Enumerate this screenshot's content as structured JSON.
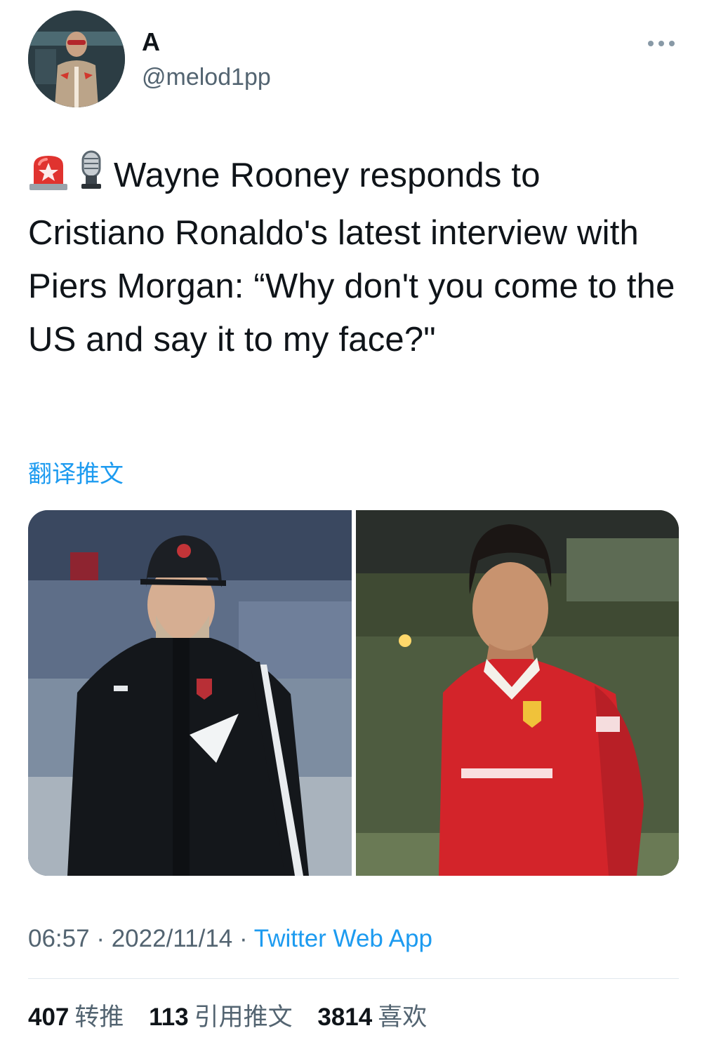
{
  "author": {
    "display_name": "A",
    "handle": "@melod1pp"
  },
  "tweet": {
    "text": "Wayne Rooney responds to Cristiano Ronaldo's latest interview with Piers Morgan: “Why don't you come to the US and say it to my face?\"",
    "emojis": [
      "rotating-light-icon",
      "microphone-icon"
    ],
    "translate_label": "翻译推文"
  },
  "meta": {
    "time": "06:57",
    "separator": " · ",
    "date": "2022/11/14",
    "source": "Twitter Web App"
  },
  "stats": {
    "retweets": "407",
    "retweets_label": "转推",
    "quotes": "113",
    "quotes_label": "引用推文",
    "likes": "3814",
    "likes_label": "喜欢"
  },
  "colors": {
    "link": "#1d9bf0",
    "secondary_text": "#536471",
    "primary_text": "#0f1419"
  }
}
